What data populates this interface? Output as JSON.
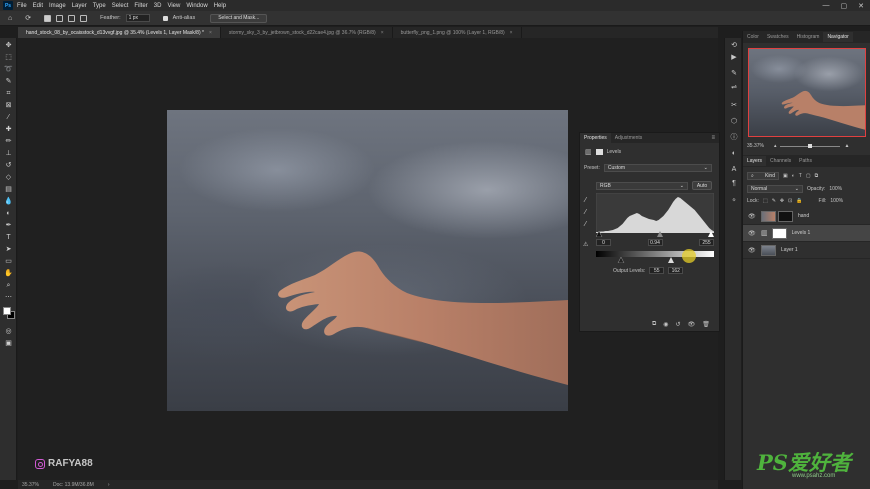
{
  "menu": {
    "logo": "Ps",
    "items": [
      "File",
      "Edit",
      "Image",
      "Layer",
      "Type",
      "Select",
      "Filter",
      "3D",
      "View",
      "Window",
      "Help"
    ]
  },
  "options_bar": {
    "feather_label": "Feather:",
    "feather_value": "1 px",
    "antialias_label": "Anti-alias",
    "select_mask_button": "Select and Mask..."
  },
  "tabs": [
    {
      "label": "hand_stock_08_by_ocaisstock_d13vvgf.jpg @ 35.4% (Levels 1, Layer Mask/8) *",
      "active": true
    },
    {
      "label": "stormy_sky_3_by_jetbrown_stock_d22cae4.jpg @ 36.7% (RGB/8)",
      "active": false
    },
    {
      "label": "butterfly_png_1.png @ 100% (Layer 1, RGB/8)",
      "active": false
    }
  ],
  "status": {
    "zoom": "35.37%",
    "doc": "Doc: 13.9M/36.8M"
  },
  "watermark_left": "RAFYA88",
  "properties": {
    "tab_active": "Properties",
    "tab_other": "Adjustments",
    "header": "Levels",
    "preset_label": "Preset:",
    "preset_value": "Custom",
    "channel_value": "RGB",
    "auto_label": "Auto",
    "input_black": "0",
    "input_mid": "0.94",
    "input_white": "255",
    "output_label": "Output Levels:",
    "output_black": "55",
    "output_white": "162",
    "histogram": [
      2,
      2,
      3,
      3,
      4,
      4,
      5,
      6,
      8,
      10,
      14,
      18,
      24,
      30,
      34,
      36,
      38,
      40,
      38,
      34,
      32,
      30,
      28,
      27,
      26,
      24,
      26,
      30,
      34,
      40,
      46,
      54,
      62,
      68,
      72,
      70,
      66,
      62,
      58,
      54,
      50,
      46,
      40,
      34,
      28,
      22,
      16,
      10,
      6,
      3
    ]
  },
  "right_dock": {
    "top_tabs": [
      "Color",
      "Swatches",
      "Histogram",
      "Navigator"
    ],
    "zoom": "35.37%",
    "layers_tabs": [
      "Layers",
      "Channels",
      "Paths"
    ],
    "kind_label": "Kind",
    "blend_mode": "Normal",
    "opacity_label": "Opacity:",
    "opacity_value": "100%",
    "lock_label": "Lock:",
    "fill_label": "Fill:",
    "fill_value": "100%",
    "layers": [
      {
        "name": "hand",
        "selected": false
      },
      {
        "name": "Levels 1",
        "selected": true
      },
      {
        "name": "Layer 1",
        "selected": false
      }
    ]
  },
  "watermark_right": "PS爱好者",
  "watermark_right_sub": "www.psahz.com"
}
